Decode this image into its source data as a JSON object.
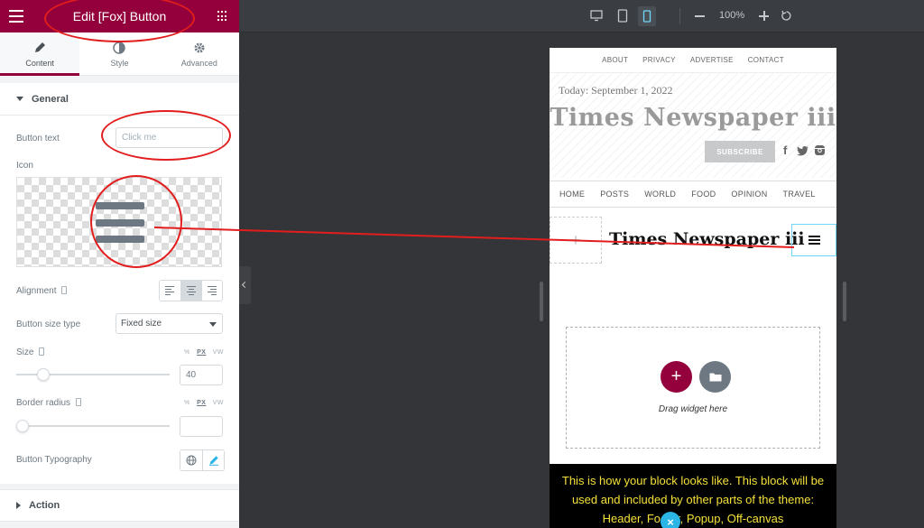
{
  "panel": {
    "title": "Edit [Fox] Button",
    "tabs": [
      {
        "label": "Content",
        "icon": "pencil-icon",
        "active": true
      },
      {
        "label": "Style",
        "icon": "half-circle-icon"
      },
      {
        "label": "Advanced",
        "icon": "gear-icon"
      }
    ],
    "sections": {
      "general": "General",
      "action": "Action"
    },
    "fields": {
      "button_text_label": "Button text",
      "button_text_placeholder": "Click me",
      "icon_label": "Icon",
      "alignment_label": "Alignment",
      "alignment_options": [
        "left",
        "center",
        "right"
      ],
      "alignment_selected": "center",
      "size_type_label": "Button size type",
      "size_type_value": "Fixed size",
      "size_label": "Size",
      "size_value": "40",
      "units_prefix": "%",
      "units_selected": "PX",
      "units_suffix": "VW",
      "size_slider_fraction": 0.15,
      "border_radius_label": "Border radius",
      "border_radius_value": "",
      "border_radius_slider_fraction": 0.0,
      "typography_label": "Button Typography"
    }
  },
  "toolbar": {
    "zoom": "100%",
    "devices": [
      "desktop-icon",
      "tablet-icon",
      "mobile-icon"
    ],
    "active_device": "mobile-icon"
  },
  "preview": {
    "top_nav": [
      "ABOUT",
      "PRIVACY",
      "ADVERTISE",
      "CONTACT"
    ],
    "date": "Today: September 1, 2022",
    "brand": "Times Newspaper iii",
    "subscribe": "SUBSCRIBE",
    "social": {
      "facebook": "f",
      "twitter": "🐦",
      "instagram": "◙"
    },
    "main_nav": [
      "HOME",
      "POSTS",
      "WORLD",
      "FOOD",
      "OPINION",
      "TRAVEL"
    ],
    "plus": "+",
    "logo": "Times Newspaper iii",
    "drop_hint": "Drag widget here",
    "note": "This is how your block looks like. This block will be used and included by other parts of the theme: Header, Footer, Popup, Off-canvas",
    "close": "×"
  },
  "colors": {
    "accent": "#93003c",
    "annotation": "#e21d1d",
    "editor_bg": "#333538",
    "note_text": "#f4e03a"
  }
}
